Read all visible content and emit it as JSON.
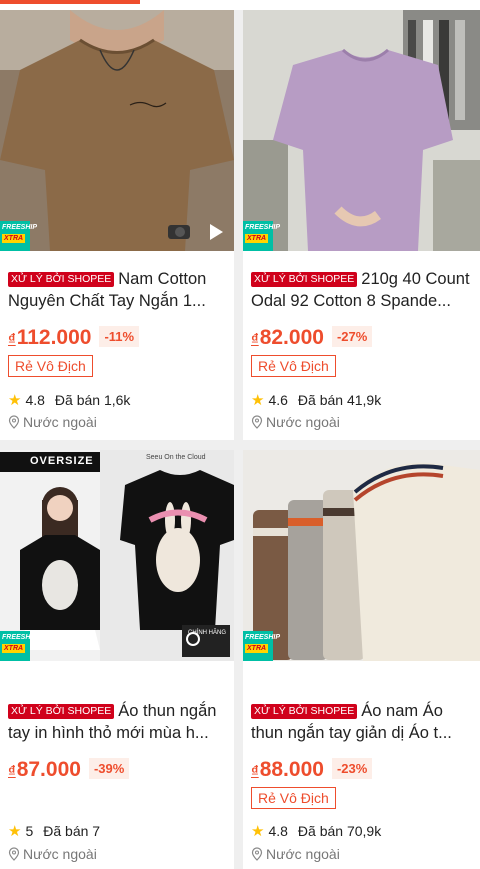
{
  "colors": {
    "accent": "#ee4d2d",
    "shopee_tag": "#d0011b",
    "freeship": "#00bfa5"
  },
  "products": [
    {
      "tag": "XỬ LÝ BỞI SHOPEE",
      "title": "Nam Cotton Nguyên Chất Tay Ngắn 1...",
      "currency": "₫",
      "price": "112.000",
      "discount": "-11%",
      "badge": "Rẻ Vô Địch",
      "rating": "4.8",
      "sold": "Đã bán 1,6k",
      "location": "Nước ngoài",
      "freeship": "FREESHIP",
      "xtra": "XTRA"
    },
    {
      "tag": "XỬ LÝ BỞI SHOPEE",
      "title": "210g 40 Count Odal 92 Cotton 8 Spande...",
      "currency": "₫",
      "price": "82.000",
      "discount": "-27%",
      "badge": "Rẻ Vô Địch",
      "rating": "4.6",
      "sold": "Đã bán 41,9k",
      "location": "Nước ngoài",
      "freeship": "FREESHIP",
      "xtra": "XTRA"
    },
    {
      "tag": "XỬ LÝ BỞI SHOPEE",
      "title": "Áo thun ngắn tay in hình thỏ mới mùa h...",
      "currency": "₫",
      "price": "87.000",
      "discount": "-39%",
      "rating": "5",
      "sold": "Đã bán 7",
      "location": "Nước ngoài",
      "freeship": "FREESHIP",
      "xtra": "XTRA",
      "image_text": {
        "oversize": "OVERSIZE",
        "brand": "Seeu On the Cloud",
        "genuine": "CHÍNH HÃNG"
      }
    },
    {
      "tag": "XỬ LÝ BỞI SHOPEE",
      "title": "Áo nam Áo thun ngắn tay giản dị Áo t...",
      "currency": "₫",
      "price": "88.000",
      "discount": "-23%",
      "badge": "Rẻ Vô Địch",
      "rating": "4.8",
      "sold": "Đã bán 70,9k",
      "location": "Nước ngoài",
      "freeship": "FREESHIP",
      "xtra": "XTRA"
    }
  ]
}
